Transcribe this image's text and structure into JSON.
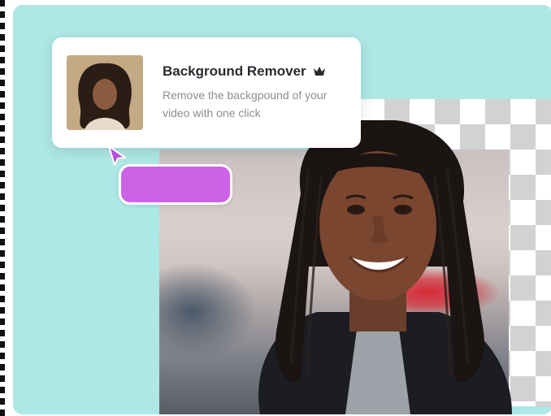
{
  "feature_card": {
    "title": "Background Remover",
    "title_icon": "crown-icon",
    "description": "Remove the backgpound of your video with one click"
  },
  "cta_button": {
    "label": ""
  },
  "colors": {
    "teal_background": "#ade7e6",
    "cta_purple": "#cc63e6",
    "cursor_purple": "#b44fe0",
    "checker_gray": "#d2d2d2"
  }
}
